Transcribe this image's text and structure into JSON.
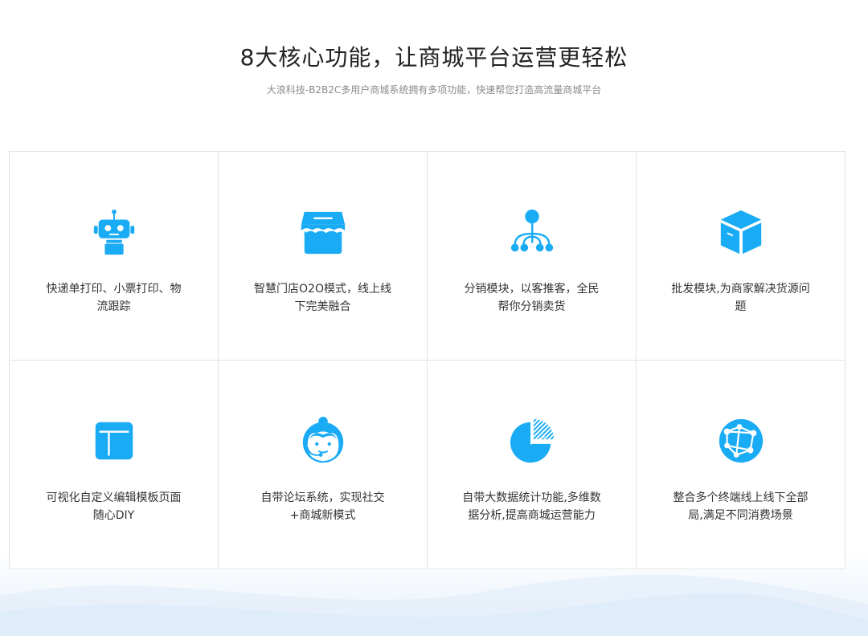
{
  "header": {
    "title": "8大核心功能，让商城平台运营更轻松",
    "subtitle": "大浪科技-B2B2C多用户商城系统拥有多项功能，快速帮您打造高流量商城平台"
  },
  "colors": {
    "accent": "#1aabf5",
    "border": "#e3e3e3",
    "text": "#333333"
  },
  "features": [
    {
      "icon": "robot-icon",
      "text": "快递单打印、小票打印、物流跟踪"
    },
    {
      "icon": "storefront-icon",
      "text": "智慧门店O2O模式，线上线下完美融合"
    },
    {
      "icon": "distribution-network-icon",
      "text": "分销模块，以客推客，全民帮你分销卖货"
    },
    {
      "icon": "package-box-icon",
      "text": "批发模块,为商家解决货源问题"
    },
    {
      "icon": "layout-template-icon",
      "text": "可视化自定义编辑模板页面随心DIY"
    },
    {
      "icon": "customer-service-icon",
      "text": "自带论坛系统，实现社交+商城新模式"
    },
    {
      "icon": "pie-chart-icon",
      "text": "自带大数据统计功能,多维数据分析,提高商城运营能力"
    },
    {
      "icon": "globe-network-icon",
      "text": "整合多个终端线上线下全部局,满足不同消费场景"
    }
  ]
}
